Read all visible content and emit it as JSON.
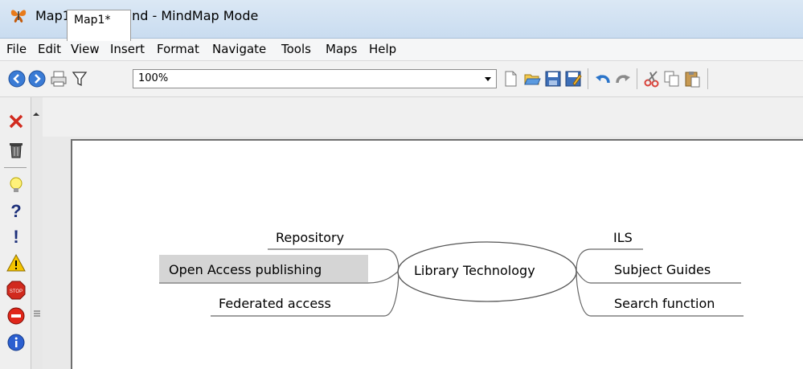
{
  "window": {
    "title": "Map1* - FreeMind - MindMap Mode"
  },
  "menubar": {
    "items": [
      "File",
      "Edit",
      "View",
      "Insert",
      "Format",
      "Navigate",
      "Tools",
      "Maps",
      "Help"
    ]
  },
  "toolbar": {
    "zoom_value": "100%",
    "icons": [
      "back-icon",
      "forward-icon",
      "print-icon",
      "filter-icon",
      "new-map-icon",
      "open-icon",
      "save-icon",
      "save-as-icon",
      "undo-icon",
      "redo-icon",
      "cut-icon",
      "copy-icon",
      "paste-icon"
    ]
  },
  "left_palette": {
    "icons": [
      "remove-icon-icon",
      "trash-icon",
      "idea-icon",
      "question-icon",
      "exclamation-icon",
      "warning-icon",
      "stop-icon",
      "stop-sign-icon",
      "info-icon"
    ]
  },
  "tabs": [
    {
      "label": "Map1*"
    }
  ],
  "mindmap": {
    "root": "Library Technology",
    "left_nodes": [
      "Repository",
      "Open Access publishing",
      "Federated access"
    ],
    "right_nodes": [
      "ILS",
      "Subject Guides",
      "Search function"
    ]
  },
  "colors": {
    "title_bar": "#c9dcf0",
    "selected_node": "#d5d5d5"
  }
}
